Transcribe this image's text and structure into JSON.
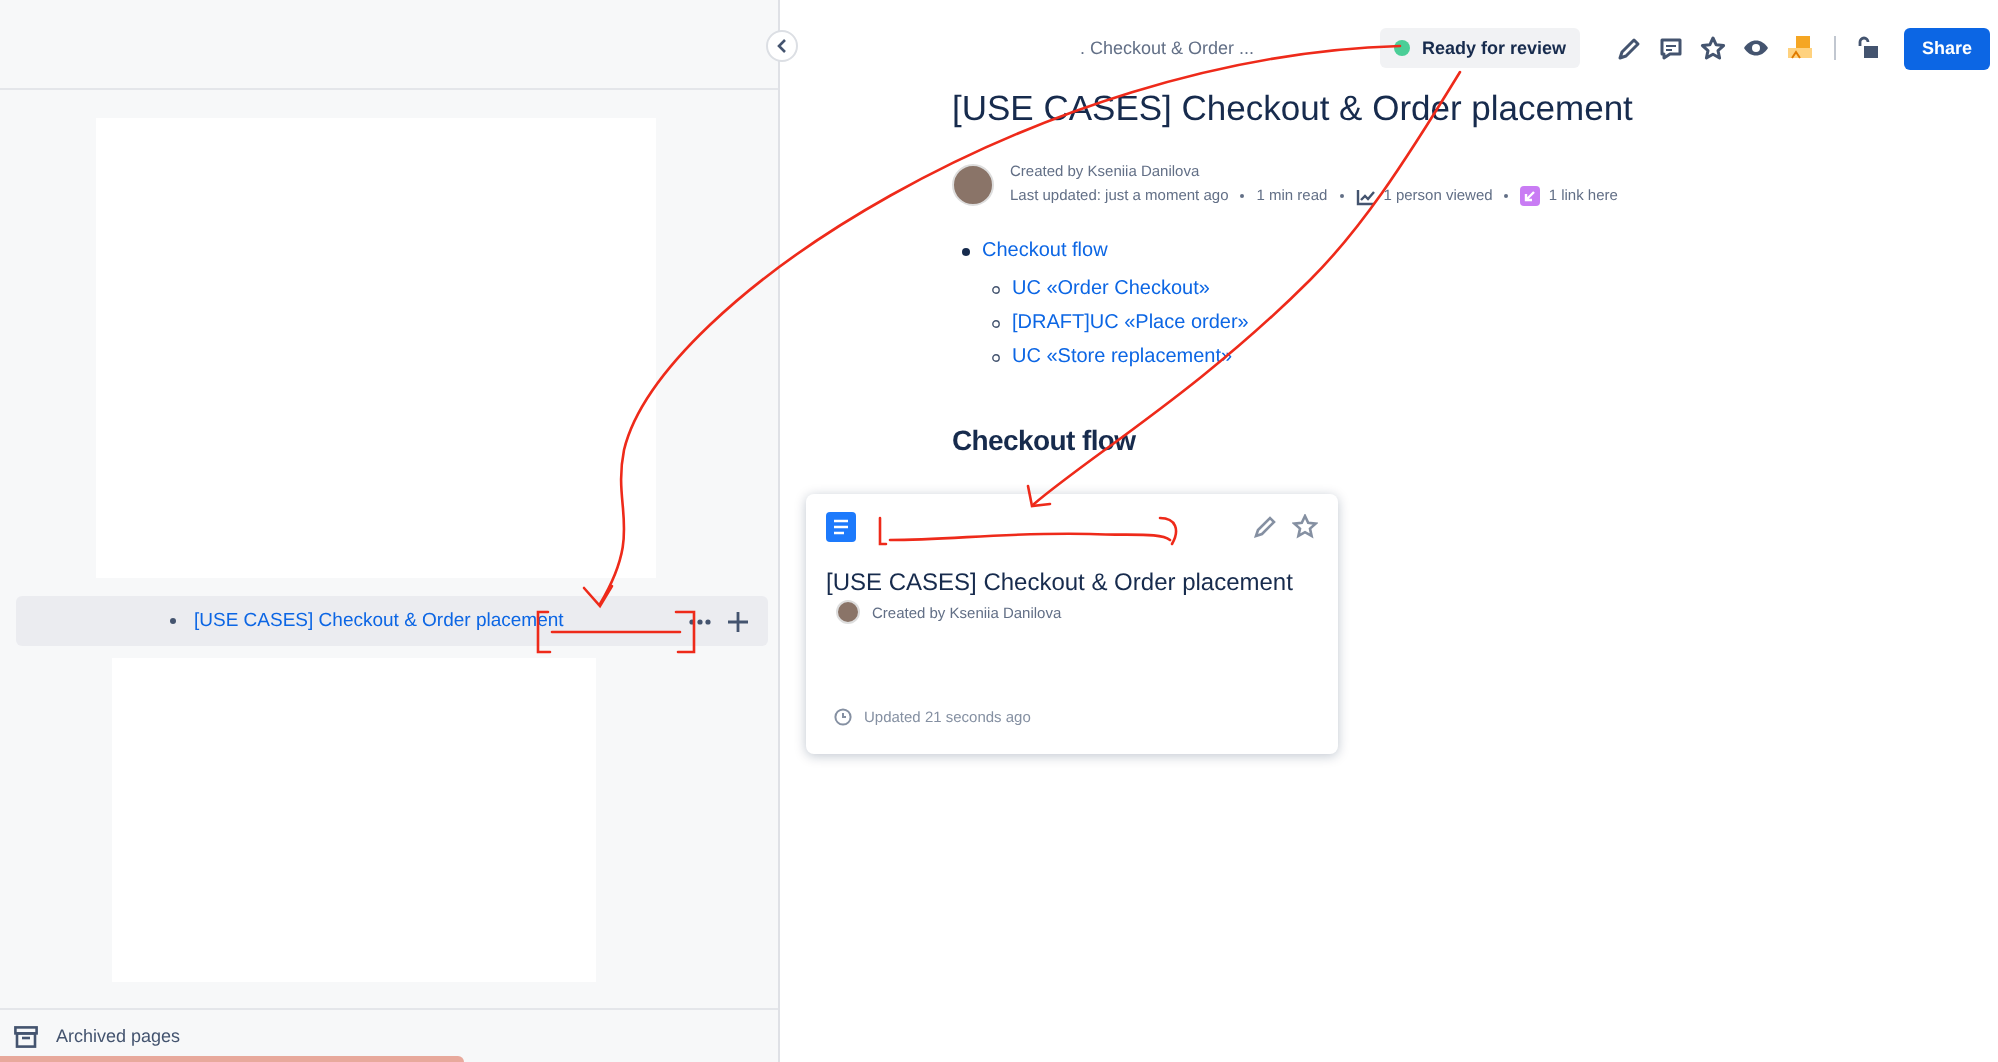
{
  "sidebar": {
    "tree_item": {
      "label": "[USE CASES] Checkout & Order placement",
      "selected": true
    },
    "archived_label": "Archived pages"
  },
  "header": {
    "breadcrumb": ". Checkout & Order ...",
    "status": "Ready for review",
    "share_label": "Share"
  },
  "page": {
    "title": "[USE CASES] Checkout & Order placement",
    "byline": "Created by Kseniia Danilova",
    "meta": [
      {
        "kind": "text",
        "label": "Last updated: just a moment ago"
      },
      {
        "kind": "text",
        "label": "1 min read"
      },
      {
        "kind": "views",
        "label": "1 person viewed"
      },
      {
        "kind": "links",
        "label": "1 link here"
      }
    ],
    "contents": [
      {
        "label": "Checkout flow",
        "children": [
          {
            "label": "UC «Order Checkout»"
          },
          {
            "label": "[DRAFT]UC «Place order»"
          },
          {
            "label": "UC «Store replacement»"
          }
        ]
      }
    ],
    "heading": "Checkout flow"
  },
  "card": {
    "title": "[USE CASES] Checkout & Order placement",
    "byline": "Created by Kseniia Danilova",
    "updated": "Updated 21 seconds ago"
  }
}
